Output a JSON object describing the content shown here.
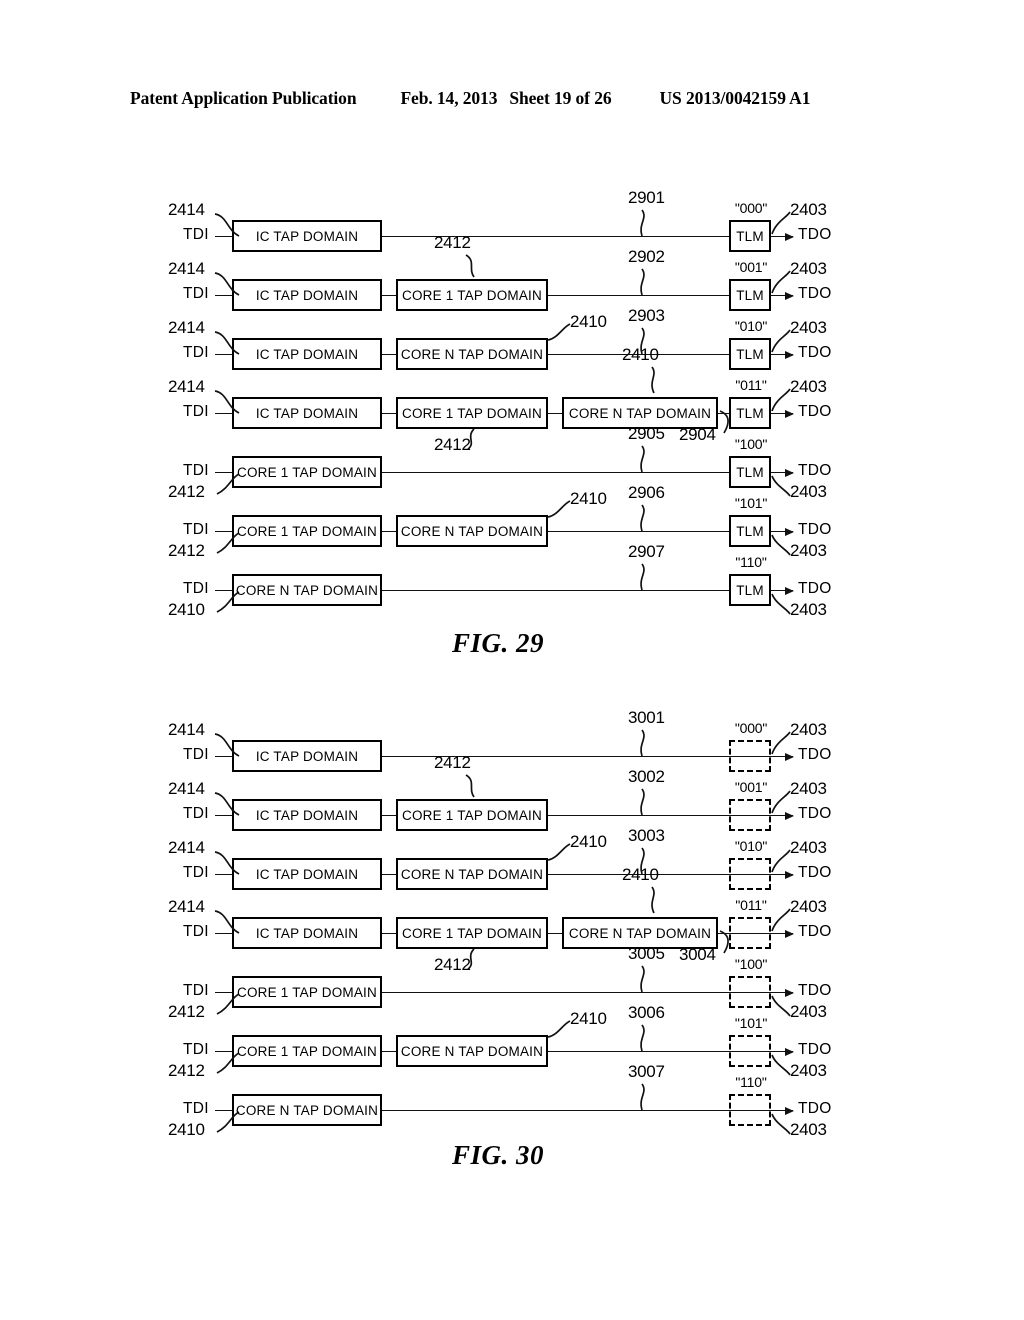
{
  "header": {
    "publication": "Patent Application Publication",
    "date": "Feb. 14, 2013",
    "sheet": "Sheet 19 of 26",
    "patent_number": "US 2013/0042159 A1"
  },
  "labels": {
    "tdi": "TDI",
    "tdo": "TDO",
    "tlm": "TLM",
    "ic_tap_domain": "IC TAP DOMAIN",
    "core1_tap_domain": "CORE 1 TAP DOMAIN",
    "coren_tap_domain": "CORE N TAP DOMAIN",
    "ref_2414": "2414",
    "ref_2412": "2412",
    "ref_2410": "2410",
    "ref_2403": "2403"
  },
  "figures": [
    {
      "id": "fig29",
      "caption": "FIG. 29",
      "tlm_style": "solid",
      "rows": [
        {
          "boxes": [
            "IC TAP DOMAIN"
          ],
          "code": "\"000\"",
          "scan_ref": "2901",
          "left_ref": "2414",
          "left_ref_pos": "above",
          "out_ref": "2403",
          "out_ref_pos": "above"
        },
        {
          "boxes": [
            "IC TAP DOMAIN",
            "CORE 1 TAP DOMAIN"
          ],
          "code": "\"001\"",
          "scan_ref": "2902",
          "left_ref": "2414",
          "left_ref_pos": "above",
          "out_ref": "2403",
          "out_ref_pos": "above",
          "box_ref": "2412",
          "box_ref_target": 2
        },
        {
          "boxes": [
            "IC TAP DOMAIN",
            "CORE N TAP DOMAIN"
          ],
          "code": "\"010\"",
          "scan_ref": "2903",
          "left_ref": "2414",
          "left_ref_pos": "above",
          "out_ref": "2403",
          "out_ref_pos": "above",
          "box_ref": "2410",
          "box_ref_target": 2
        },
        {
          "boxes": [
            "IC TAP DOMAIN",
            "CORE 1 TAP DOMAIN",
            "CORE N TAP DOMAIN"
          ],
          "code": "\"011\"",
          "scan_ref": "2904",
          "left_ref": "2414",
          "left_ref_pos": "above",
          "out_ref": "2403",
          "out_ref_pos": "above",
          "box_ref": "2410",
          "box_ref_target": 3,
          "box_ref2": "2412",
          "box_ref2_target": 2
        },
        {
          "boxes": [
            "CORE 1 TAP DOMAIN"
          ],
          "code": "\"100\"",
          "scan_ref": "2905",
          "left_ref": "2412",
          "left_ref_pos": "below",
          "out_ref": "2403",
          "out_ref_pos": "below"
        },
        {
          "boxes": [
            "CORE 1 TAP DOMAIN",
            "CORE N TAP DOMAIN"
          ],
          "code": "\"101\"",
          "scan_ref": "2906",
          "left_ref": "2412",
          "left_ref_pos": "below",
          "out_ref": "2403",
          "out_ref_pos": "below",
          "box_ref": "2410",
          "box_ref_target": 2
        },
        {
          "boxes": [
            "CORE N TAP DOMAIN"
          ],
          "code": "\"110\"",
          "scan_ref": "2907",
          "left_ref": "2410",
          "left_ref_pos": "below",
          "out_ref": "2403",
          "out_ref_pos": "below"
        }
      ]
    },
    {
      "id": "fig30",
      "caption": "FIG. 30",
      "tlm_style": "dashed",
      "rows": [
        {
          "boxes": [
            "IC TAP DOMAIN"
          ],
          "code": "\"000\"",
          "scan_ref": "3001",
          "left_ref": "2414",
          "left_ref_pos": "above",
          "out_ref": "2403",
          "out_ref_pos": "above"
        },
        {
          "boxes": [
            "IC TAP DOMAIN",
            "CORE 1 TAP DOMAIN"
          ],
          "code": "\"001\"",
          "scan_ref": "3002",
          "left_ref": "2414",
          "left_ref_pos": "above",
          "out_ref": "2403",
          "out_ref_pos": "above",
          "box_ref": "2412",
          "box_ref_target": 2
        },
        {
          "boxes": [
            "IC TAP DOMAIN",
            "CORE N TAP DOMAIN"
          ],
          "code": "\"010\"",
          "scan_ref": "3003",
          "left_ref": "2414",
          "left_ref_pos": "above",
          "out_ref": "2403",
          "out_ref_pos": "above",
          "box_ref": "2410",
          "box_ref_target": 2
        },
        {
          "boxes": [
            "IC TAP DOMAIN",
            "CORE 1 TAP DOMAIN",
            "CORE N TAP DOMAIN"
          ],
          "code": "\"011\"",
          "scan_ref": "3004",
          "left_ref": "2414",
          "left_ref_pos": "above",
          "out_ref": "2403",
          "out_ref_pos": "above",
          "box_ref": "2410",
          "box_ref_target": 3,
          "box_ref2": "2412",
          "box_ref2_target": 2
        },
        {
          "boxes": [
            "CORE 1 TAP DOMAIN"
          ],
          "code": "\"100\"",
          "scan_ref": "3005",
          "left_ref": "2412",
          "left_ref_pos": "below",
          "out_ref": "2403",
          "out_ref_pos": "below"
        },
        {
          "boxes": [
            "CORE 1 TAP DOMAIN",
            "CORE N TAP DOMAIN"
          ],
          "code": "\"101\"",
          "scan_ref": "3006",
          "left_ref": "2412",
          "left_ref_pos": "below",
          "out_ref": "2403",
          "out_ref_pos": "below",
          "box_ref": "2410",
          "box_ref_target": 2
        },
        {
          "boxes": [
            "CORE N TAP DOMAIN"
          ],
          "code": "\"110\"",
          "scan_ref": "3007",
          "left_ref": "2410",
          "left_ref_pos": "below",
          "out_ref": "2403",
          "out_ref_pos": "below"
        }
      ]
    }
  ]
}
